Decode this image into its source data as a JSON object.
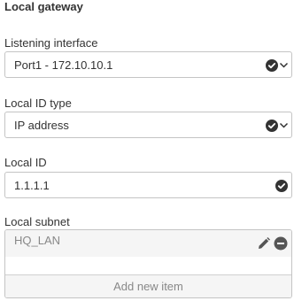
{
  "section": {
    "title": "Local gateway"
  },
  "listening_interface": {
    "label": "Listening interface",
    "value": "Port1 - 172.10.10.1"
  },
  "local_id_type": {
    "label": "Local ID type",
    "value": "IP address"
  },
  "local_id": {
    "label": "Local ID",
    "value": "1.1.1.1"
  },
  "local_subnet": {
    "label": "Local subnet",
    "items": [
      {
        "text": "HQ_LAN"
      }
    ],
    "add_label": "Add new item"
  },
  "icons": {
    "valid": "check-circle-icon",
    "dropdown": "chevron-down-icon",
    "edit": "pencil-icon",
    "remove": "minus-circle-icon"
  },
  "colors": {
    "icon": "#333333",
    "border": "#c4c4c4",
    "muted_text": "#888888"
  }
}
